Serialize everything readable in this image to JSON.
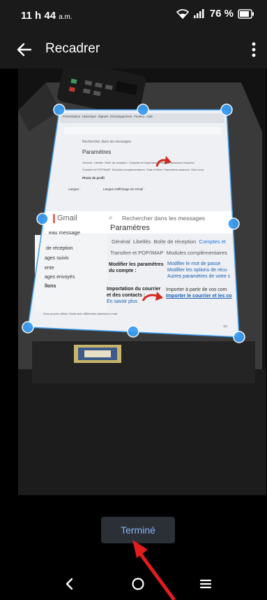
{
  "status": {
    "time": "11 h 44",
    "ampm": "a.m.",
    "battery": "76 %",
    "network": "LTE"
  },
  "appbar": {
    "title": "Recadrer",
    "back_icon": "arrow-back-icon",
    "more_icon": "more-vert-icon"
  },
  "document": {
    "top_menu": [
      "Présentation",
      "Historique",
      "Signets",
      "Développement",
      "Fenêtre",
      "Aide"
    ],
    "top_search": "Rechercher dans les messages",
    "top_heading": "Paramètres",
    "top_tabs": [
      "Général",
      "Libellés",
      "Boîte de réception",
      "Comptes et importation",
      "Filtres et adresses bloquées"
    ],
    "top_subtabs": [
      "Transfert et POP/IMAP",
      "Modules complémentaires",
      "Chat et Meet",
      "Paramètres avancés",
      "Hors conn."
    ],
    "photo_row_label": "Photo de profil",
    "lang_label": "Langue :",
    "lang_value": "Langue d'affichage de Gmail :",
    "main_brand": "Gmail",
    "main_search": "Rechercher dans les messages",
    "main_heading": "Paramètres",
    "main_tabs": [
      "Général",
      "Libellés",
      "Boîte de réception",
      "Comptes et"
    ],
    "main_subtabs": [
      "Transfert et POP/IMAP",
      "Modules complémentaires"
    ],
    "sidebar": [
      "eau message",
      "de réception",
      "ages suivis",
      "ente",
      "ages envoyés",
      "llons"
    ],
    "row1_label": "Modifier les paramètres du compte :",
    "row1_links": [
      "Modifier le mot de passe",
      "Modifier les options de récu",
      "Autres paramètres de votre c"
    ],
    "row2_label": "Importation du courrier et des contacts :",
    "row2_link_more": "En savoir plus",
    "row2_text": "Importer à partir de vos com",
    "row2_link": "Importer le courrier et les co",
    "footer_note": "Vous pouvez utiliser Gmail avec différentes adresses e-mail.",
    "page_num": "1/1"
  },
  "done_label": "Terminé",
  "nav": {
    "back_icon": "nav-back-icon",
    "home_icon": "nav-home-icon",
    "recents_icon": "nav-recents-icon"
  },
  "colors": {
    "handle": "#3b9cf0",
    "accent_text": "#8ab4f8",
    "arrow": "#e11d1d"
  }
}
